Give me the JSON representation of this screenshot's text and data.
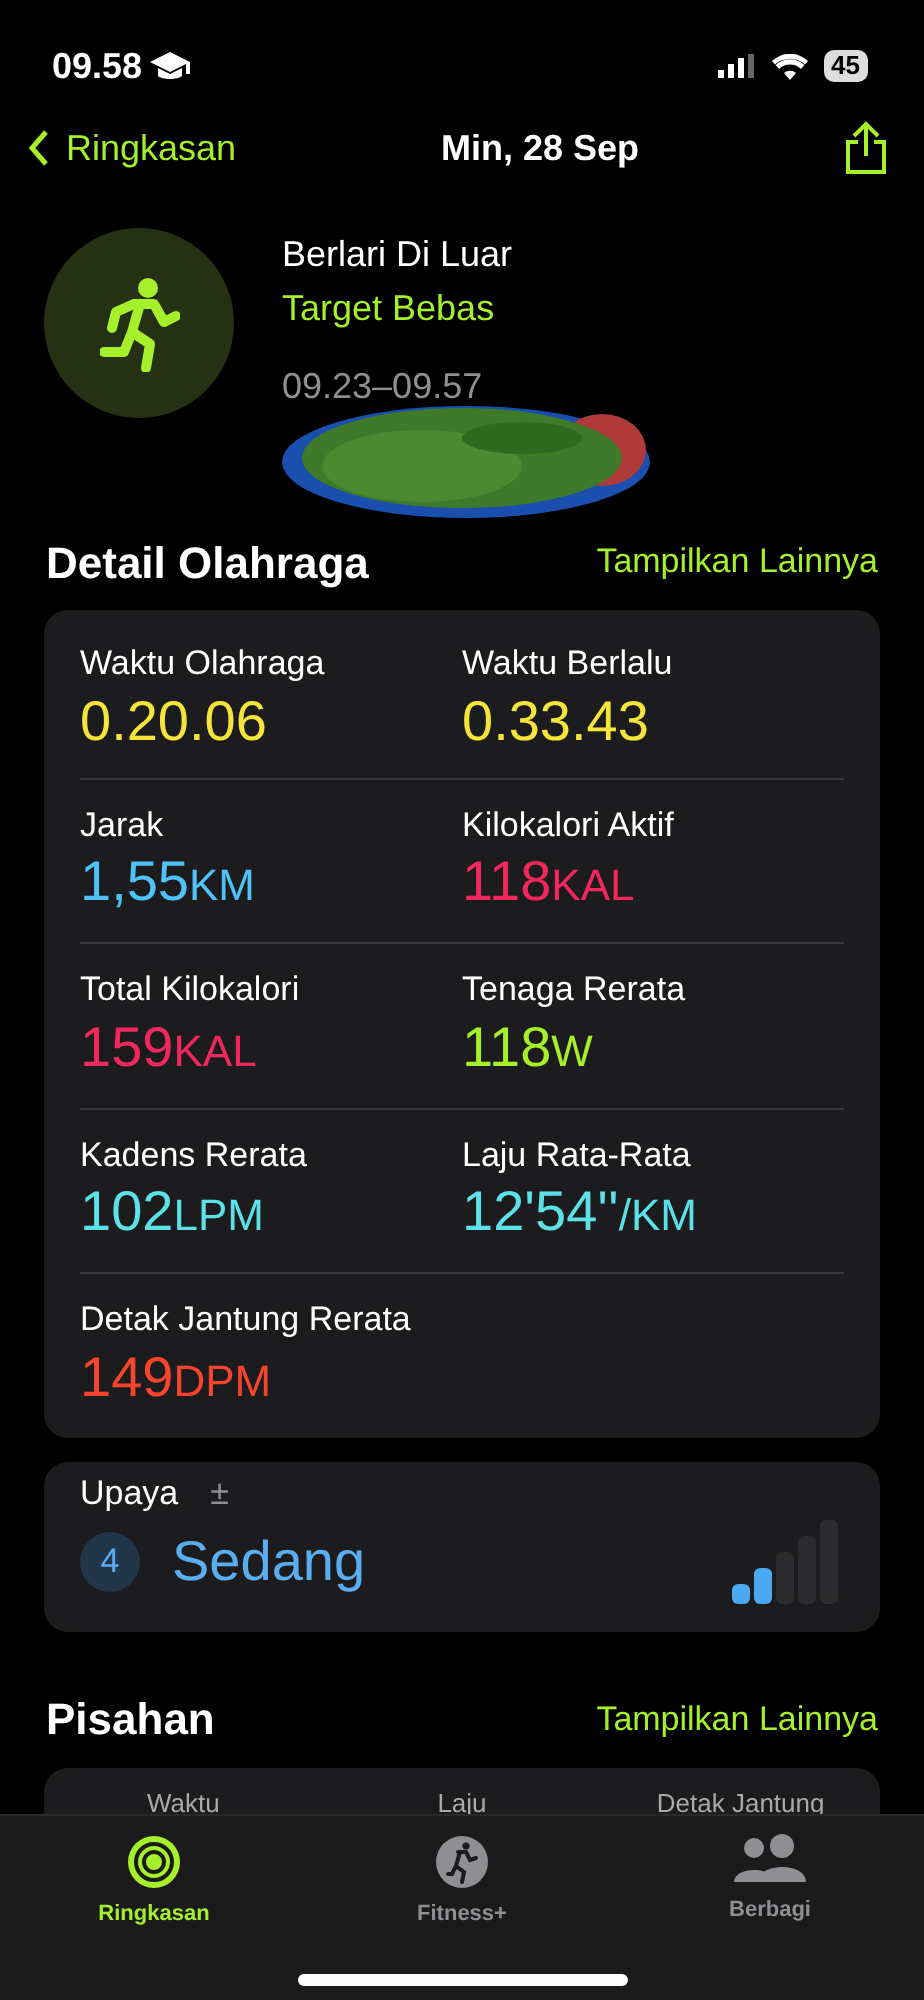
{
  "status_bar": {
    "time": "09.58",
    "battery": "45"
  },
  "nav": {
    "back": "Ringkasan",
    "title": "Min, 28 Sep"
  },
  "workout": {
    "name": "Berlari Di Luar",
    "goal": "Target Bebas",
    "time_range": "09.23–09.57"
  },
  "details": {
    "title": "Detail Olahraga",
    "more": "Tampilkan Lainnya",
    "metrics": [
      {
        "label": "Waktu Olahraga",
        "value": "0.20.06",
        "color": "#f5e53b"
      },
      {
        "label": "Waktu Berlalu",
        "value": "0.33.43",
        "color": "#f5e53b"
      },
      {
        "label": "Jarak",
        "value": "1,55",
        "unit": "KM",
        "color": "#4fc3f7"
      },
      {
        "label": "Kilokalori Aktif",
        "value": "118",
        "unit": "KAL",
        "color": "#f2275d"
      },
      {
        "label": "Total Kilokalori",
        "value": "159",
        "unit": "KAL",
        "color": "#f2275d"
      },
      {
        "label": "Tenaga Rerata",
        "value": "118",
        "unit": "W",
        "color": "#a5f02a"
      },
      {
        "label": "Kadens Rerata",
        "value": "102",
        "unit": "LPM",
        "color": "#5ce1e6"
      },
      {
        "label": "Laju Rata-Rata",
        "value": "12'54''",
        "unit": "/KM",
        "color": "#5ce1e6"
      },
      {
        "label": "Detak Jantung Rerata",
        "value": "149",
        "unit": "DPM",
        "color": "#f5462d"
      }
    ]
  },
  "effort": {
    "label": "Upaya",
    "adjust": "±",
    "score": "4",
    "rating": "Sedang",
    "level": 0.4
  },
  "splits": {
    "title": "Pisahan",
    "more": "Tampilkan Lainnya",
    "columns": [
      "Waktu",
      "Laju",
      "Detak Jantung"
    ]
  },
  "tabs": [
    {
      "label": "Ringkasan",
      "selected": true,
      "kind": "rings"
    },
    {
      "label": "Fitness+",
      "selected": false,
      "kind": "runner"
    },
    {
      "label": "Berbagi",
      "selected": false,
      "kind": "people"
    }
  ]
}
